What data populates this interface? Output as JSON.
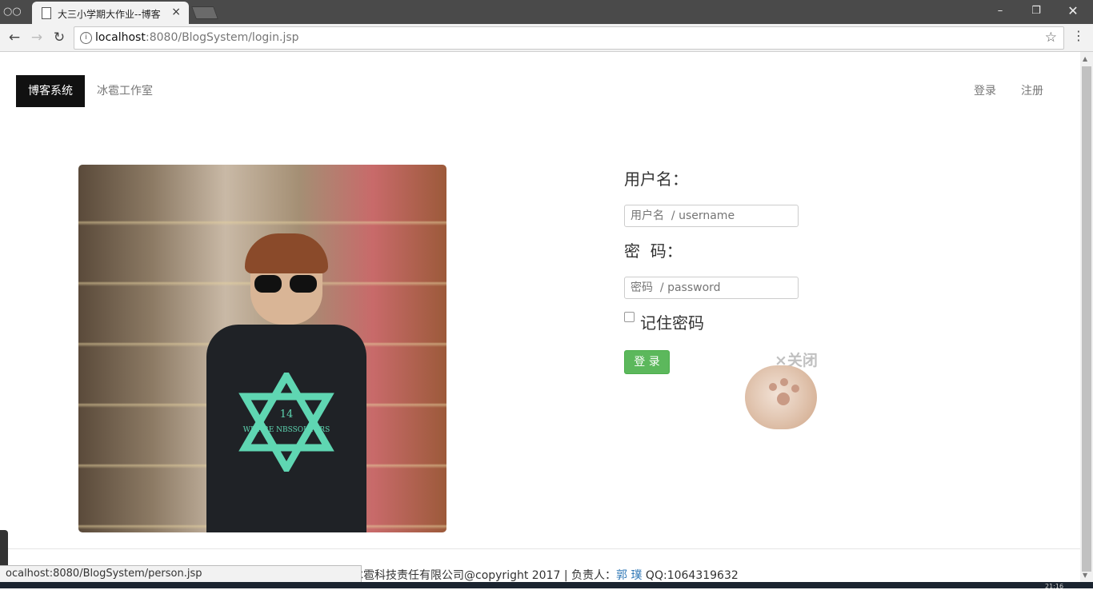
{
  "browser": {
    "tab_title": "大三小学期大作业--博客",
    "url_host": "localhost",
    "url_rest": ":8080/BlogSystem/login.jsp",
    "tab_close": "×",
    "status_url": "ocalhost:8080/BlogSystem/person.jsp",
    "clock": "21:16"
  },
  "nav": {
    "brand": "博客系统",
    "studio": "冰雹工作室",
    "login": "登录",
    "register": "注册"
  },
  "login_form": {
    "username_label": "用户名：",
    "username_placeholder": "用户名  / username",
    "password_label": "密  码：",
    "password_placeholder": "密码  / password",
    "remember_label": "记住密码",
    "submit_label": "登 录"
  },
  "widget": {
    "close_label": "×关闭"
  },
  "footer": {
    "company_text": "冰雹科技责任有限公司@copyright 2017 | 负责人：",
    "owner_name": "郭 璞",
    "qq_text": " QQ:1064319632"
  },
  "photo_text": {
    "shirt_number": "14",
    "shirt_slogan": "WE ARE NBSSOUTERS"
  }
}
